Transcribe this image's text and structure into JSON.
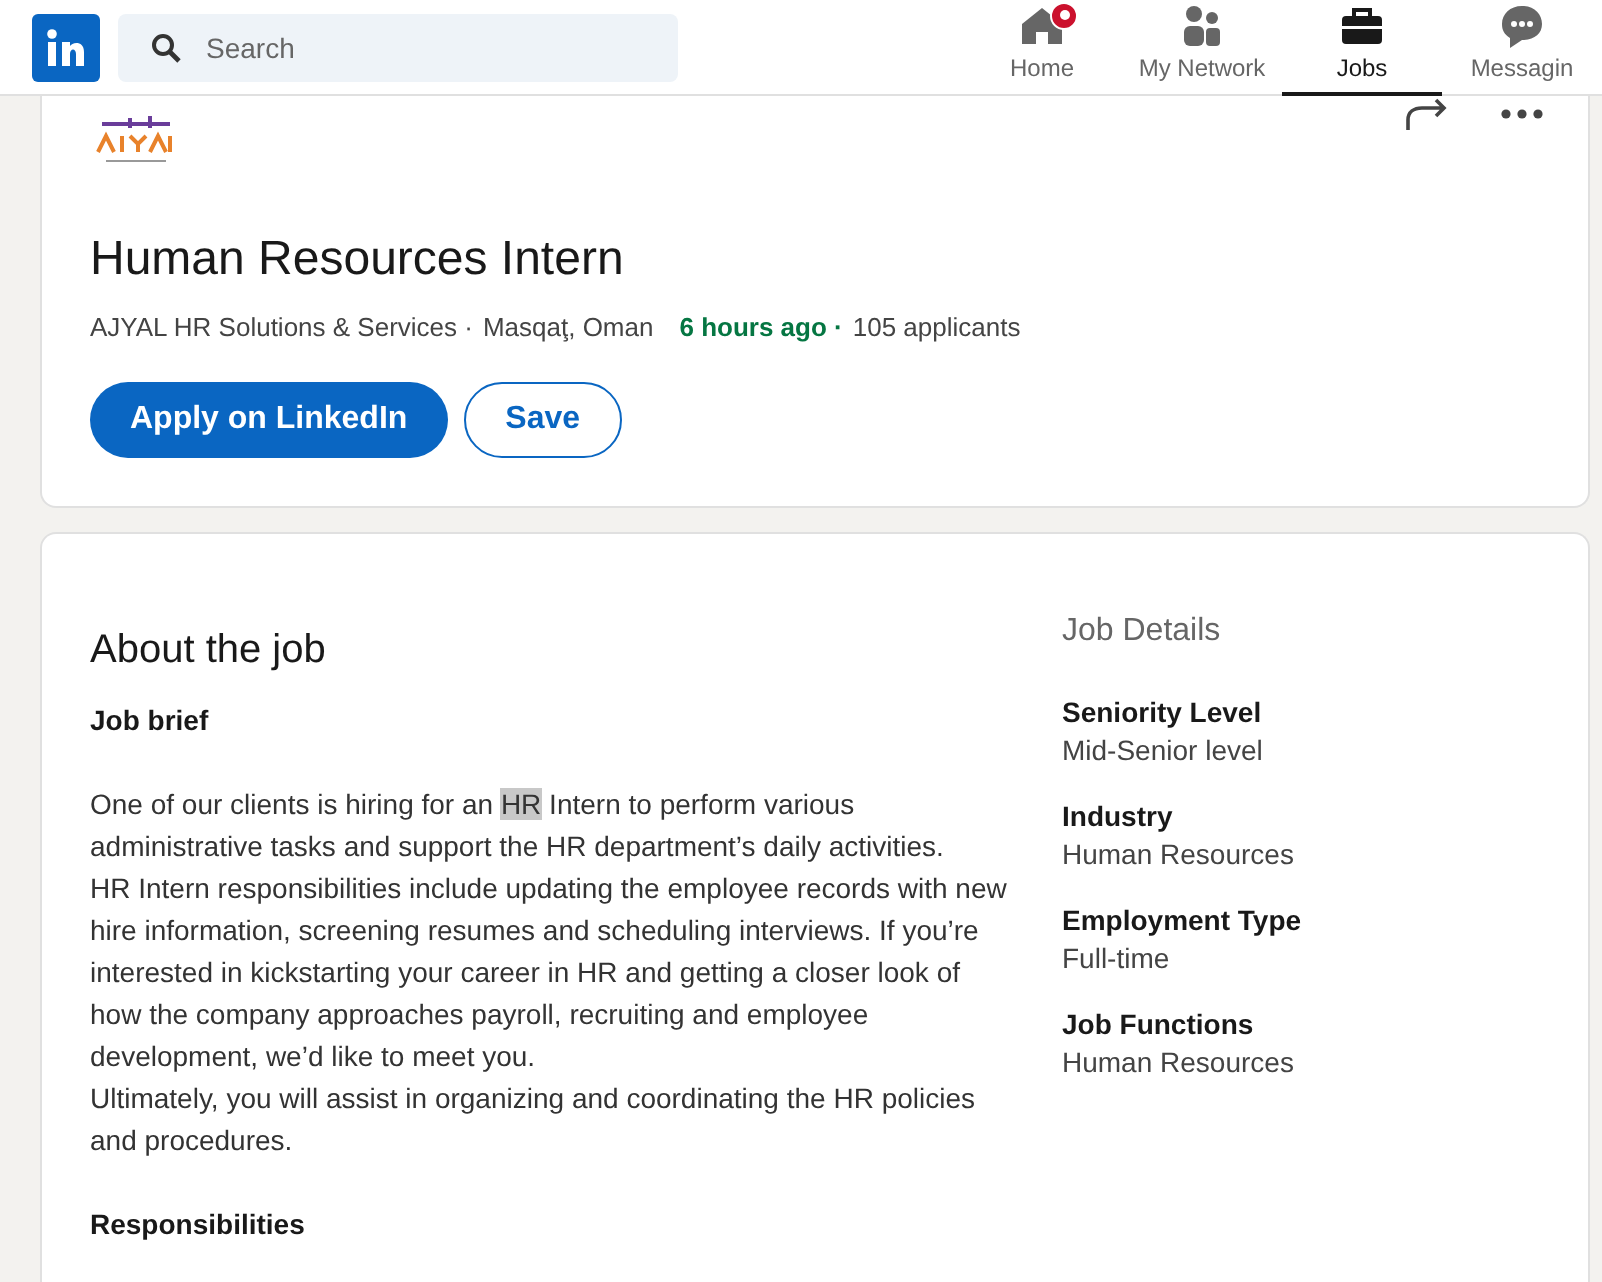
{
  "nav": {
    "search": {
      "placeholder": "Search"
    },
    "items": [
      {
        "label": "Home",
        "kind": "home",
        "selected": false,
        "badge": true
      },
      {
        "label": "My Network",
        "kind": "network",
        "selected": false,
        "badge": false
      },
      {
        "label": "Jobs",
        "kind": "jobs",
        "selected": true,
        "badge": false
      },
      {
        "label": "Messagin",
        "kind": "messaging",
        "selected": false,
        "badge": false
      }
    ]
  },
  "job": {
    "title": "Human Resources Intern",
    "company": "AJYAL HR Solutions & Services ·",
    "location": "Masqaţ, Oman",
    "posted": "6 hours ago ·",
    "applicants": "105 applicants",
    "apply": "Apply on LinkedIn",
    "save": "Save"
  },
  "about": {
    "heading": "About the job",
    "brief": "Job brief",
    "paragraphs": [
      {
        "before": "One of our clients is hiring for an ",
        "highlighted": "HR",
        "after": " Intern to perform various administrative tasks and support the HR department’s daily activities."
      },
      {
        "before": "HR Intern responsibilities include updating the employee records with new hire information, screening resumes and scheduling interviews. If you’re interested in kickstarting your career in HR and getting a closer look of how the company approaches payroll, recruiting and employee development, we’d like to meet you."
      },
      {
        "before": "Ultimately, you will assist in organizing and coordinating the HR policies and procedures."
      }
    ],
    "responsibilities": "Responsibilities"
  },
  "details": {
    "heading": "Job Details",
    "items": [
      {
        "label": "Seniority Level",
        "value": "Mid-Senior level"
      },
      {
        "label": "Industry",
        "value": "Human Resources"
      },
      {
        "label": "Employment Type",
        "value": "Full-time"
      },
      {
        "label": "Job Functions",
        "value": "Human Resources"
      }
    ]
  }
}
